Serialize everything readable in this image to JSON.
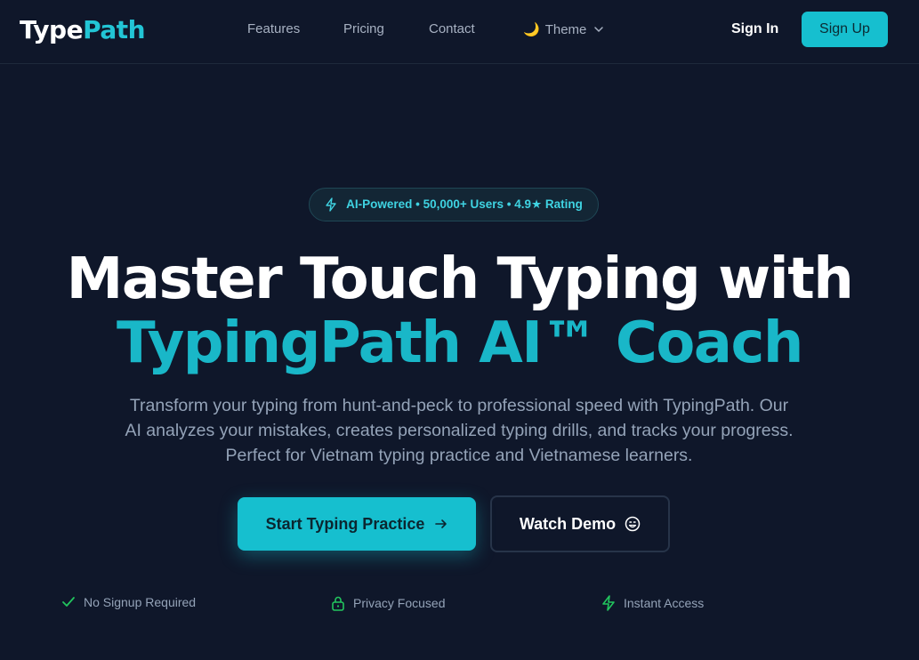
{
  "nav": {
    "logo_part1": "Type",
    "logo_part2": "Path",
    "links": [
      "Features",
      "Pricing",
      "Contact"
    ],
    "theme_label": "Theme",
    "theme_icon": "moon-icon",
    "signin_label": "Sign In",
    "signup_label": "Sign Up"
  },
  "hero": {
    "badge": "AI-Powered • 50,000+ Users • 4.9★ Rating",
    "title_line1": "Master Touch Typing with",
    "title_line2": "TypingPath AI™ Coach",
    "subtitle_lines": [
      "Transform your typing from hunt-and-peck to professional speed with TypingPath. Our",
      "AI analyzes your mistakes, creates personalized typing drills, and tracks your progress.",
      "Perfect for Vietnam typing practice and Vietnamese learners."
    ],
    "primary_cta": "Start Typing Practice",
    "secondary_cta": "Watch Demo"
  },
  "features": [
    "No Signup Required",
    "Privacy Focused",
    "Instant Access"
  ],
  "colors": {
    "background": "#0f172a",
    "accent": "#16bfcf",
    "accent_text": "#19b7c8",
    "muted_text": "#94a3b8",
    "feature_icon": "#22c55e"
  }
}
